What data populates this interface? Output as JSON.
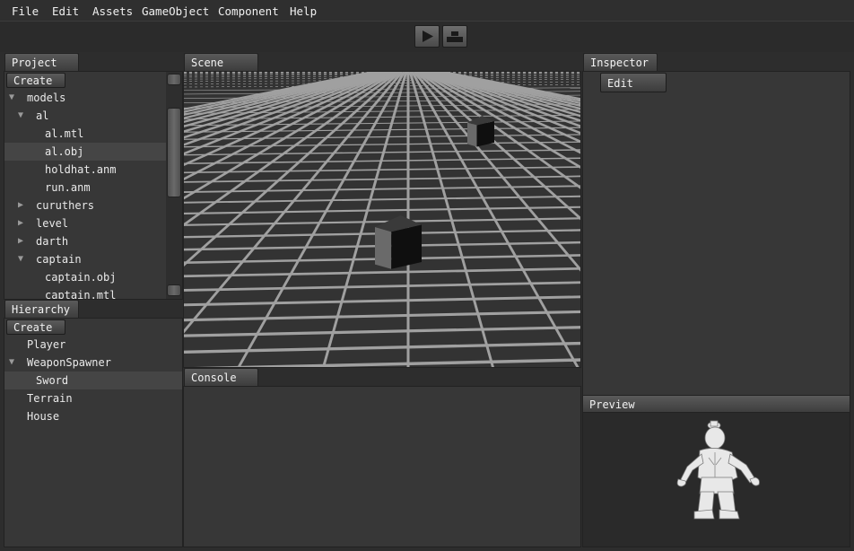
{
  "menu": [
    "File",
    "Edit",
    "Assets",
    "GameObject",
    "Component",
    "Help"
  ],
  "toolbar": {
    "play_icon": "play-icon",
    "layers_icon": "layers-icon"
  },
  "project": {
    "tab": "Project",
    "create_label": "Create",
    "tree": [
      {
        "label": "models",
        "depth": 0,
        "arrow": "expanded"
      },
      {
        "label": "al",
        "depth": 1,
        "arrow": "expanded"
      },
      {
        "label": "al.mtl",
        "depth": 2,
        "arrow": "none"
      },
      {
        "label": "al.obj",
        "depth": 2,
        "arrow": "none",
        "selected": true
      },
      {
        "label": "holdhat.anm",
        "depth": 2,
        "arrow": "none"
      },
      {
        "label": "run.anm",
        "depth": 2,
        "arrow": "none"
      },
      {
        "label": "curuthers",
        "depth": 1,
        "arrow": "collapsed"
      },
      {
        "label": "level",
        "depth": 1,
        "arrow": "collapsed"
      },
      {
        "label": "darth",
        "depth": 1,
        "arrow": "collapsed"
      },
      {
        "label": "captain",
        "depth": 1,
        "arrow": "expanded"
      },
      {
        "label": "captain.obj",
        "depth": 2,
        "arrow": "none"
      },
      {
        "label": "captain.mtl",
        "depth": 2,
        "arrow": "none"
      }
    ]
  },
  "hierarchy": {
    "tab": "Hierarchy",
    "create_label": "Create",
    "tree": [
      {
        "label": "Player",
        "depth": 0,
        "arrow": "none"
      },
      {
        "label": "WeaponSpawner",
        "depth": 0,
        "arrow": "expanded"
      },
      {
        "label": "Sword",
        "depth": 1,
        "arrow": "none",
        "selected": true
      },
      {
        "label": "Terrain",
        "depth": 0,
        "arrow": "none"
      },
      {
        "label": "House",
        "depth": 0,
        "arrow": "none"
      }
    ]
  },
  "scene": {
    "tab": "Scene"
  },
  "console": {
    "tab": "Console"
  },
  "inspector": {
    "tab": "Inspector",
    "edit_label": "Edit"
  },
  "preview": {
    "tab": "Preview"
  },
  "colors": {
    "panel": "#373737",
    "selection": "#454545",
    "grid_line": "#a0a0a0"
  }
}
